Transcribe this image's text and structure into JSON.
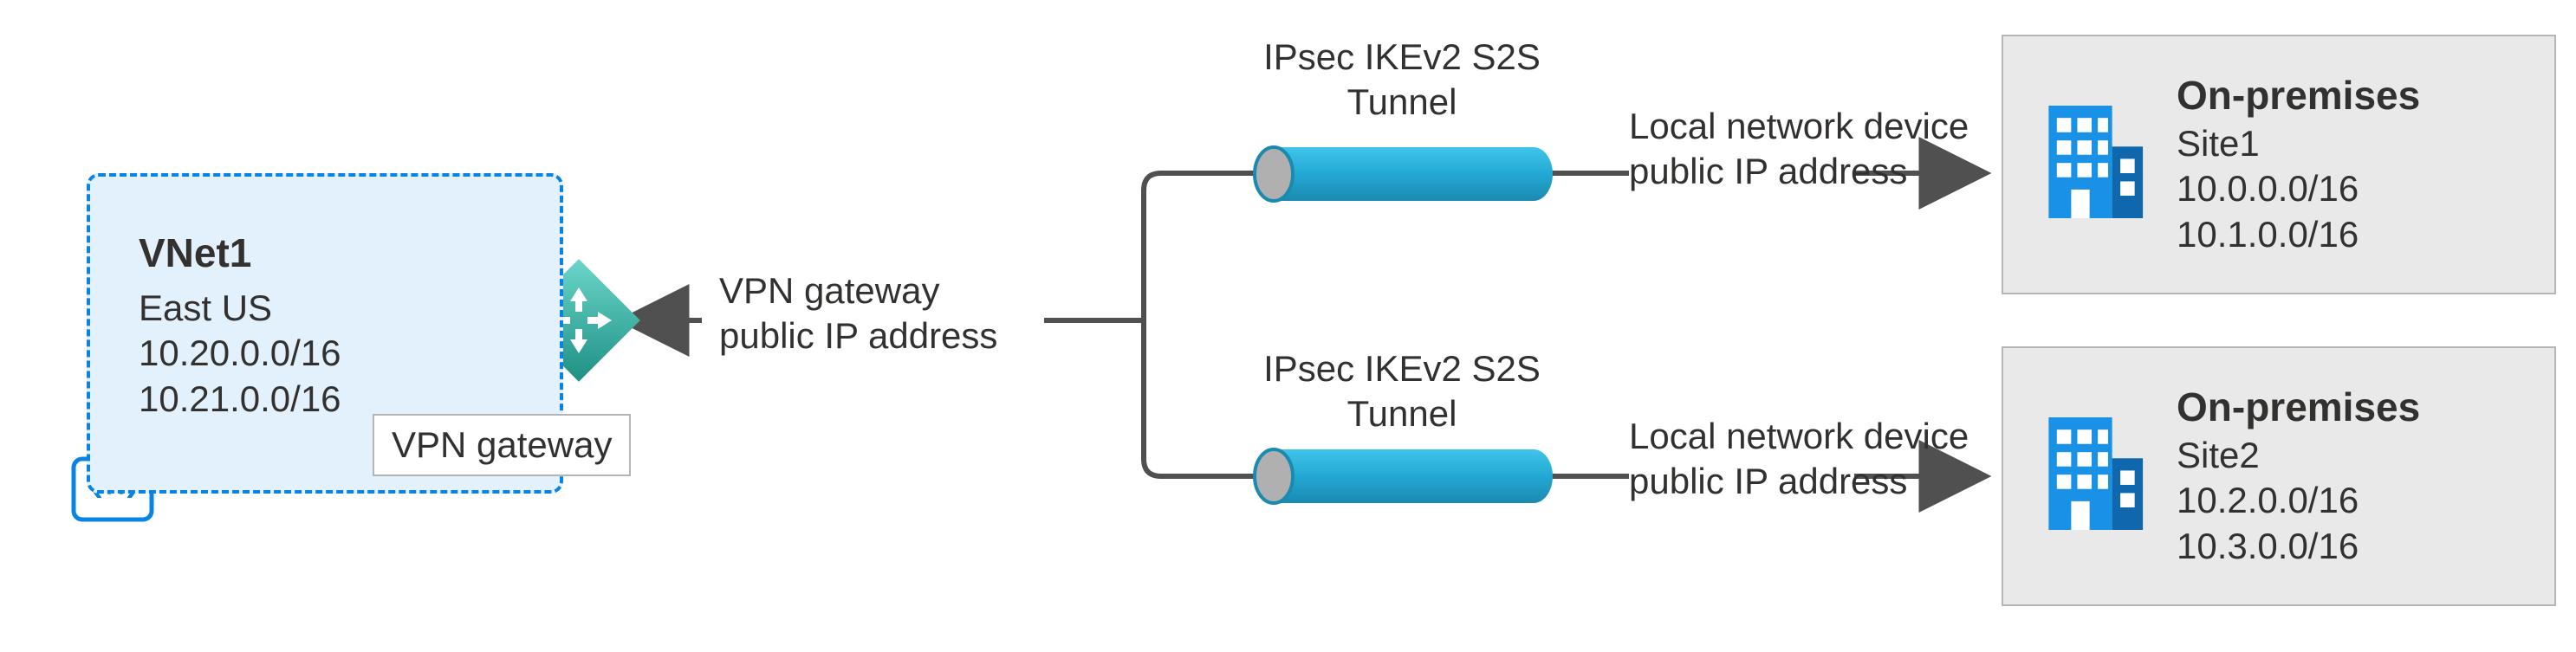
{
  "vnet": {
    "title": "VNet1",
    "region": "East US",
    "cidr1": "10.20.0.0/16",
    "cidr2": "10.21.0.0/16"
  },
  "gateway": {
    "label": "VPN gateway",
    "desc_line1": "VPN gateway",
    "desc_line2": "public IP address"
  },
  "tunnels": {
    "top": {
      "line1": "IPsec IKEv2 S2S",
      "line2": "Tunnel"
    },
    "bottom": {
      "line1": "IPsec IKEv2 S2S",
      "line2": "Tunnel"
    }
  },
  "local_device": {
    "top": {
      "line1": "Local network device",
      "line2": "public IP address"
    },
    "bottom": {
      "line1": "Local network device",
      "line2": "public IP address"
    }
  },
  "onprem": {
    "top": {
      "title": "On-premises",
      "site": "Site1",
      "cidr1": "10.0.0.0/16",
      "cidr2": "10.1.0.0/16"
    },
    "bottom": {
      "title": "On-premises",
      "site": "Site2",
      "cidr1": "10.2.0.0/16",
      "cidr2": "10.3.0.0/16"
    }
  },
  "colors": {
    "azure_blue": "#0a84e4",
    "teal": "#2aa9b0",
    "teal_dark": "#1f8288",
    "tunnel_blue": "#23a8d4",
    "box_gray": "#e9e9e9",
    "border_gray": "#b5b5b5",
    "line": "#505050"
  }
}
